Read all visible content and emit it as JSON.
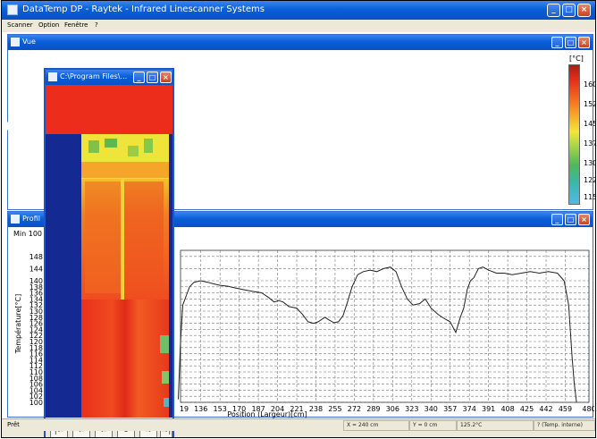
{
  "app": {
    "title": "DataTemp DP - Raytek - Infrared Linescanner Systems"
  },
  "menu": [
    "Scanner",
    "Option",
    "Fenêtre",
    "?"
  ],
  "icons": {
    "app": "app-icon",
    "minimize": "minimize-icon",
    "maximize": "maximize-icon",
    "close": "close-icon"
  },
  "vue_window": {
    "title": "Vue",
    "colorbar": {
      "unit": "[°C]",
      "ticks": [
        "160",
        "152",
        "145",
        "137",
        "130",
        "122",
        "115"
      ]
    }
  },
  "profil_window": {
    "title": "Profil",
    "min_label": "Min 100"
  },
  "thermal_window": {
    "title": "C:\\Program Files\\...",
    "controls": [
      "|⇦",
      "⇦",
      "⇦",
      "⏸",
      "⇨",
      "⇨|"
    ]
  },
  "chart_data": {
    "type": "line",
    "xlabel": "Position (Largeur)[cm]",
    "ylabel": "Température[°C]",
    "ylim": [
      100,
      150
    ],
    "y_ticks": [
      100,
      102,
      104,
      106,
      108,
      110,
      112,
      114,
      116,
      118,
      120,
      122,
      124,
      126,
      128,
      130,
      132,
      134,
      136,
      138,
      140,
      144,
      148
    ],
    "x_ticks": [
      "136",
      "153",
      "170",
      "187",
      "204",
      "221",
      "238",
      "255",
      "272",
      "289",
      "306",
      "323",
      "340",
      "357",
      "374",
      "391",
      "408",
      "425",
      "442",
      "459",
      "480"
    ],
    "x_partial_ticks": [
      "19"
    ],
    "grid": true,
    "series": [
      {
        "x": [
          116,
          118,
          120,
          123,
          126,
          130,
          136,
          142,
          147,
          153,
          160,
          167,
          175,
          182,
          190,
          196,
          201,
          205,
          209,
          214,
          221,
          226,
          231,
          236,
          240,
          246,
          250,
          254,
          258,
          262,
          266,
          270,
          275,
          280,
          286,
          292,
          298,
          304,
          309,
          314,
          319,
          324,
          330,
          335,
          340,
          346,
          352,
          357,
          362,
          366,
          369,
          372,
          375,
          378,
          382,
          386,
          391,
          398,
          405,
          412,
          420,
          428,
          436,
          444,
          452,
          458,
          462,
          465,
          467,
          469
        ],
        "values": [
          101,
          120,
          132,
          135,
          138,
          139.5,
          140,
          139.5,
          139,
          138.5,
          138.2,
          137.6,
          137,
          136.5,
          136,
          134.5,
          133,
          133.5,
          133,
          131.5,
          131,
          129,
          126.5,
          126,
          126.5,
          128,
          127,
          126.2,
          126.5,
          128.5,
          133,
          138,
          142,
          143,
          143.5,
          143,
          144,
          144.5,
          143,
          138,
          134,
          132,
          132.5,
          134,
          131,
          129,
          127.5,
          126.5,
          123,
          128,
          131,
          137,
          140,
          141,
          144,
          144.5,
          143.5,
          142.5,
          142.5,
          142,
          142.5,
          143,
          142.5,
          143,
          142.5,
          140,
          132,
          115,
          106,
          100
        ]
      }
    ]
  },
  "status": {
    "ready": "Prêt",
    "x": "X = 240 cm",
    "y": "Y = 0 cm",
    "temp": "125.2°C",
    "mode": "? (Temp. interne)"
  }
}
